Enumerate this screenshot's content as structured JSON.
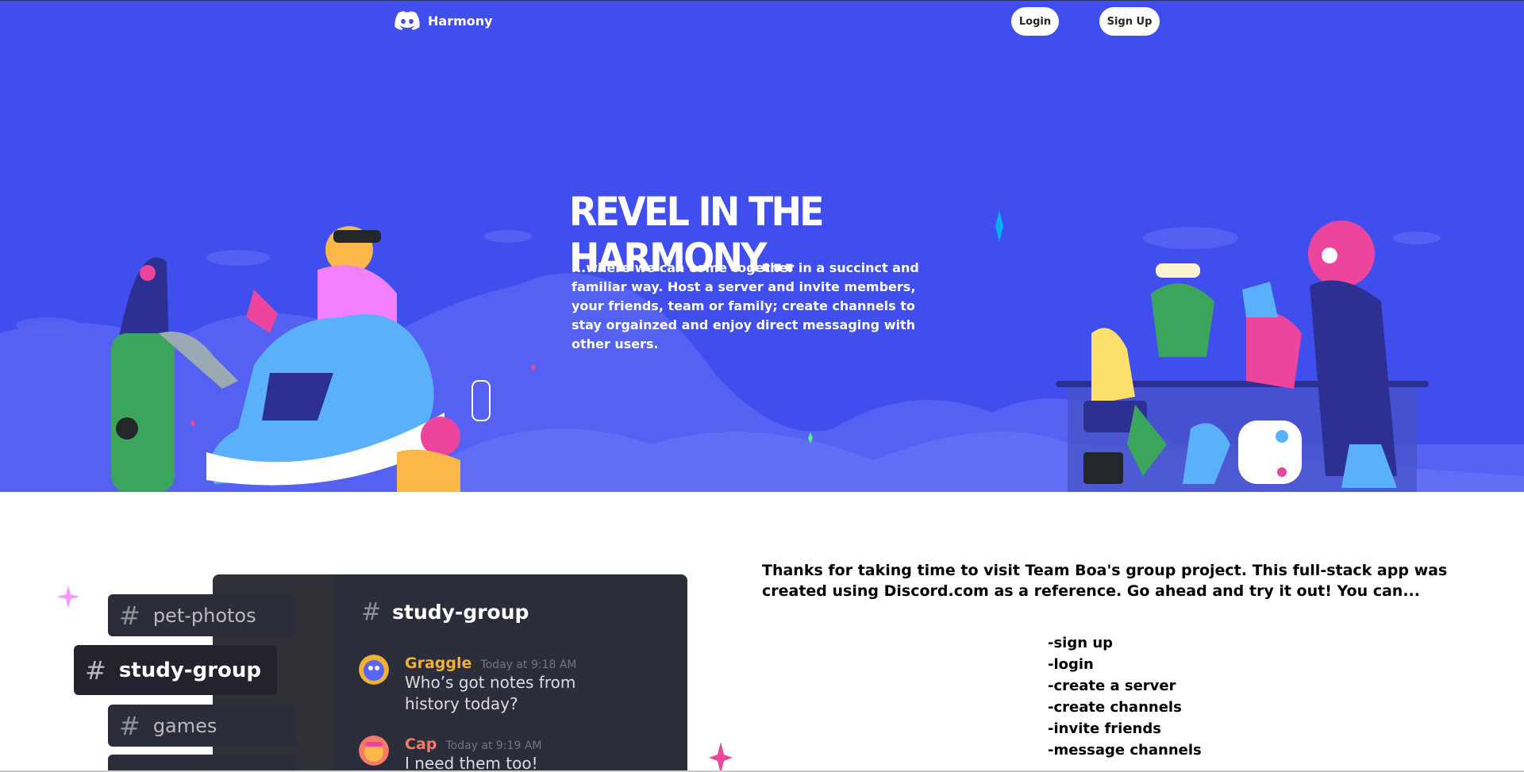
{
  "nav": {
    "brand": "Harmony",
    "login_label": "Login",
    "signup_label": "Sign Up"
  },
  "hero": {
    "title": "REVEL IN THE HARMONY...",
    "text": "...where we can come together in a succinct and familiar way. Host a server and invite members, your friends, team or family; create channels to stay orgainzed and enjoy direct messaging with other users."
  },
  "chat_demo": {
    "channels": [
      {
        "label": "pet-photos"
      },
      {
        "label": "study-group"
      },
      {
        "label": "games"
      }
    ],
    "active_channel": "study-group",
    "messages": [
      {
        "author": "Graggle",
        "time": "Today at 9:18 AM",
        "text": "Who’s got notes from history today?",
        "author_color": "#f0b232"
      },
      {
        "author": "Cap",
        "time": "Today at 9:19 AM",
        "text": "I need them too!",
        "author_color": "#f47b67"
      }
    ]
  },
  "about": {
    "text": "Thanks for taking time to visit Team Boa's group project. This full-stack app was created using Discord.com as a reference. Go ahead and try it out! You can...",
    "features": [
      "-sign up",
      "-login",
      "-create a server",
      "-create channels",
      "-invite friends",
      "-message channels"
    ]
  },
  "colors": {
    "hero_bg": "#404eed",
    "accent_pink": "#eb459e",
    "accent_green": "#57f287"
  }
}
